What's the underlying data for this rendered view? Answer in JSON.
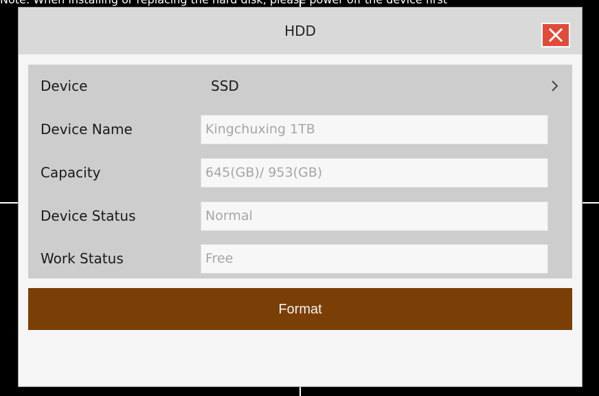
{
  "notice": {
    "text": "Note: When installing or replacing the hard disk, please power off the device first"
  },
  "dialog": {
    "title": "HDD",
    "close_icon": "close-x-icon"
  },
  "rows": [
    {
      "label": "Device",
      "value": "SSD"
    },
    {
      "label": "Device Name",
      "value": "Kingchuxing 1TB"
    },
    {
      "label": "Capacity",
      "value": "645(GB)/ 953(GB)"
    },
    {
      "label": "Device Status",
      "value": "Normal"
    },
    {
      "label": "Work Status",
      "value": "Free"
    }
  ],
  "format": {
    "label": "Format"
  },
  "colors": {
    "background": "#000000",
    "dialog": "#f5f5f5",
    "titlebar": "#d9d9d9",
    "panel": "#cdcdcd",
    "close": "#e04b3a",
    "format_button": "#7a3f07"
  }
}
